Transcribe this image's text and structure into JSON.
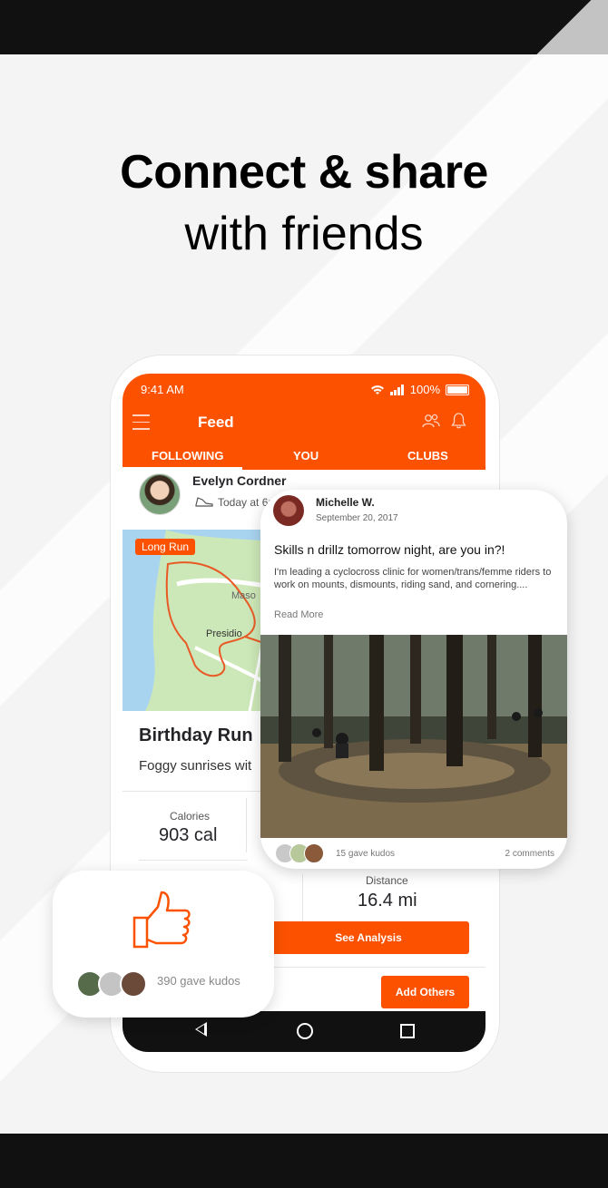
{
  "headline": {
    "line1": "Connect & share",
    "line2": "with friends"
  },
  "colors": {
    "accent": "#fc5200",
    "nav_bar": "#111111"
  },
  "status_bar": {
    "time": "9:41 AM",
    "battery": "100%",
    "icons": [
      "wifi-icon",
      "signal-icon",
      "battery-icon"
    ]
  },
  "app_bar": {
    "title": "Feed",
    "icons": [
      "menu-icon",
      "friends-icon",
      "bell-icon"
    ]
  },
  "tabs": [
    {
      "label": "FOLLOWING",
      "active": true
    },
    {
      "label": "YOU",
      "active": false
    },
    {
      "label": "CLUBS",
      "active": false
    }
  ],
  "activity": {
    "athlete": "Evelyn Cordner",
    "time": "Today at 6:",
    "tag": "Long Run",
    "map_labels": [
      "Maso",
      "Presidio"
    ],
    "title": "Birthday Run",
    "description": "Foggy sunrises wit",
    "stats": [
      {
        "label": "Calories",
        "value": "903 cal"
      },
      {
        "label": "Distance",
        "value": "16.4 mi"
      }
    ],
    "analysis_button": "See Analysis",
    "add_others_button": "Add Others"
  },
  "post": {
    "author": "Michelle W.",
    "date": "September 20, 2017",
    "title": "Skills n drillz tomorrow night, are you in?!",
    "body": "I'm leading a cyclocross clinic for women/trans/femme riders to work on mounts, dismounts, riding sand, and cornering....",
    "read_more": "Read More",
    "kudos": "15 gave kudos",
    "comments": "2 comments"
  },
  "kudos_card": {
    "count": "390 gave kudos",
    "icon": "thumbs-up-icon"
  }
}
